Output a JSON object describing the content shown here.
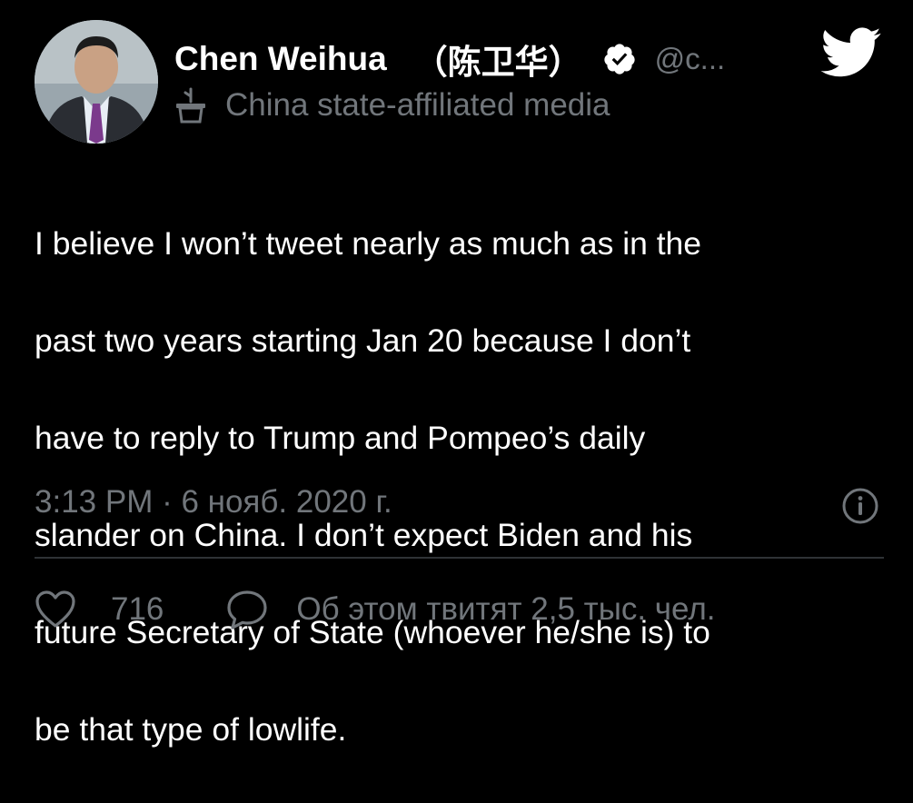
{
  "author": {
    "display_name": "Chen Weihua",
    "native_name": "（陈卫华）",
    "handle": "@c...",
    "affiliation_label": "China state-affiliated media",
    "verified": true
  },
  "icons": {
    "verified": "verified-badge-icon",
    "logo": "twitter-bird-icon",
    "affiliation": "state-media-podium-icon",
    "info": "info-icon",
    "like": "heart-icon",
    "reply": "speech-bubble-icon"
  },
  "tweet": {
    "lines": [
      "I believe I won’t tweet nearly as much as in the",
      "past two years starting Jan 20 because I don’t",
      "have to reply to Trump and Pompeo’s daily",
      "slander on China.  I don’t expect Biden and his",
      "future Secretary of State (whoever he/she is) to",
      "be that type of lowlife."
    ],
    "timestamp": "3:13 PM · 6 нояб. 2020 г."
  },
  "engagement": {
    "likes": "716",
    "discussion": "Об этом твитят 2,5 тыс. чел."
  },
  "colors": {
    "background": "#000000",
    "primary_text": "#ffffff",
    "secondary_text": "#71767b",
    "divider": "#2f3336",
    "logo": "#ffffff"
  }
}
